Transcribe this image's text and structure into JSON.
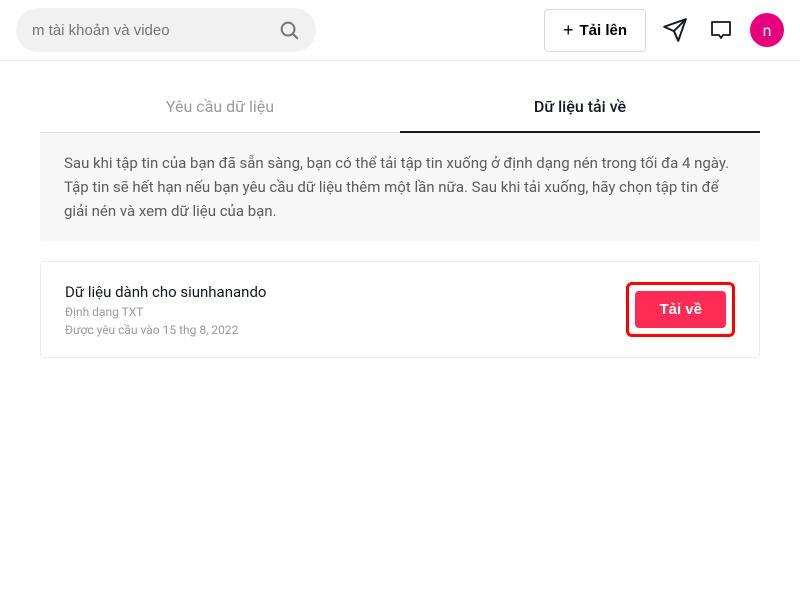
{
  "header": {
    "search_placeholder": "m tài khoản và video",
    "upload_label": "Tải lên",
    "avatar_letter": "n"
  },
  "tabs": {
    "request": "Yêu cầu dữ liệu",
    "download": "Dữ liệu tải về"
  },
  "info_text": "Sau khi tập tin của bạn đã sẵn sàng, bạn có thể tải tập tin xuống ở định dạng nén trong tối đa 4 ngày. Tập tin sẽ hết hạn nếu bạn yêu cầu dữ liệu thêm một lần nữa. Sau khi tải xuống, hãy chọn tập tin để giải nén và xem dữ liệu của bạn.",
  "download_item": {
    "title": "Dữ liệu dành cho siunhanando",
    "format": "Định dạng TXT",
    "requested": "Được yêu cầu vào 15 thg 8, 2022",
    "button": "Tải về"
  }
}
